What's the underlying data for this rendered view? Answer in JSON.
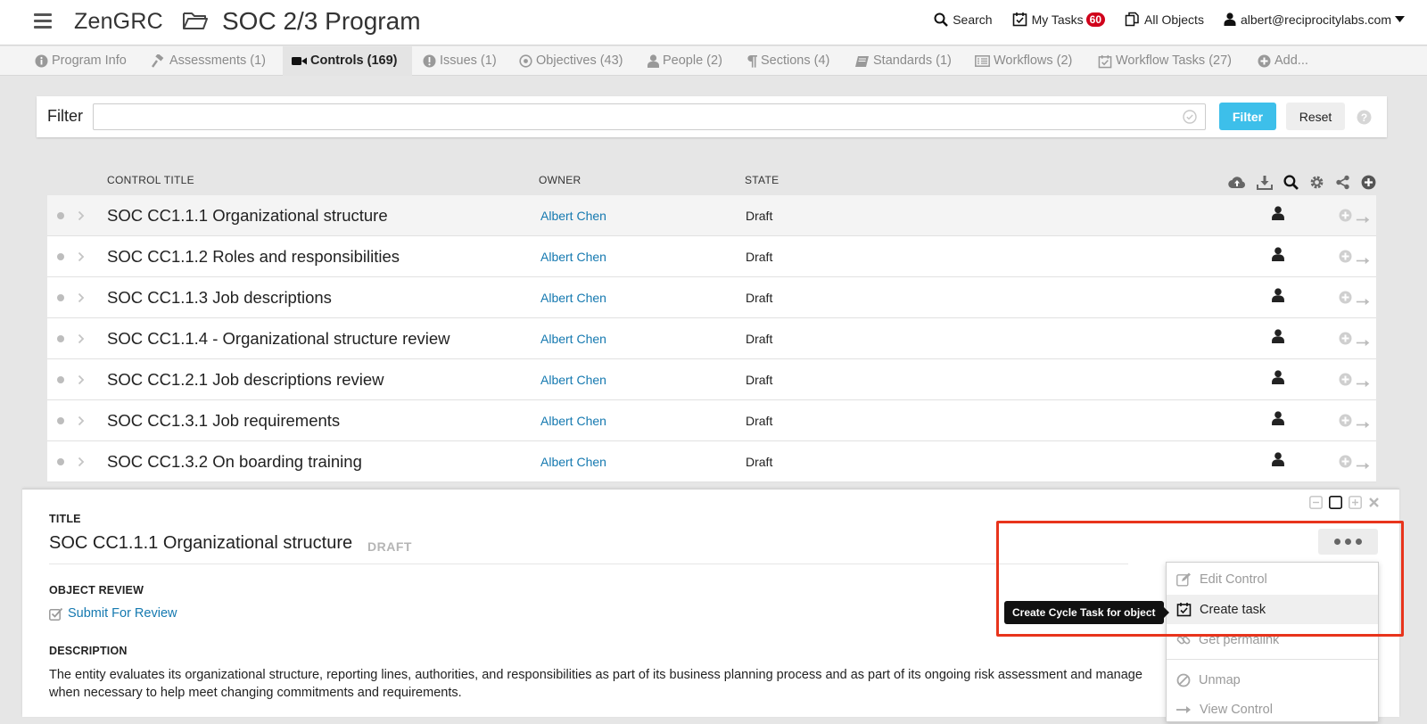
{
  "app": {
    "brand": "ZenGRC",
    "page_title": "SOC 2/3 Program"
  },
  "header": {
    "search_label": "Search",
    "my_tasks_label": "My Tasks",
    "my_tasks_count": "60",
    "all_objects_label": "All Objects",
    "user_email": "albert@reciprocitylabs.com"
  },
  "tabs": [
    {
      "label": "Program Info",
      "icon": "info-icon"
    },
    {
      "label": "Assessments (1)",
      "icon": "gavel-icon"
    },
    {
      "label": "Controls (169)",
      "icon": "video-camera-icon",
      "active": true
    },
    {
      "label": "Issues (1)",
      "icon": "exclamation-icon"
    },
    {
      "label": "Objectives (43)",
      "icon": "target-icon"
    },
    {
      "label": "People (2)",
      "icon": "person-icon"
    },
    {
      "label": "Sections (4)",
      "icon": "paragraph-icon"
    },
    {
      "label": "Standards (1)",
      "icon": "book-icon"
    },
    {
      "label": "Workflows (2)",
      "icon": "list-icon"
    },
    {
      "label": "Workflow Tasks (27)",
      "icon": "calendar-check-icon"
    },
    {
      "label": "Add...",
      "icon": "plus-circle-icon"
    }
  ],
  "filter": {
    "label": "Filter",
    "value": "",
    "filter_button": "Filter",
    "reset_button": "Reset"
  },
  "table": {
    "columns": {
      "title": "CONTROL TITLE",
      "owner": "OWNER",
      "state": "STATE"
    },
    "rows": [
      {
        "title": "SOC CC1.1.1 Organizational structure",
        "owner": "Albert Chen",
        "state": "Draft"
      },
      {
        "title": "SOC CC1.1.2 Roles and responsibilities",
        "owner": "Albert Chen",
        "state": "Draft"
      },
      {
        "title": "SOC CC1.1.3 Job descriptions",
        "owner": "Albert Chen",
        "state": "Draft"
      },
      {
        "title": "SOC CC1.1.4 - Organizational structure review",
        "owner": "Albert Chen",
        "state": "Draft"
      },
      {
        "title": "SOC CC1.2.1 Job descriptions review",
        "owner": "Albert Chen",
        "state": "Draft"
      },
      {
        "title": "SOC CC1.3.1 Job requirements",
        "owner": "Albert Chen",
        "state": "Draft"
      },
      {
        "title": "SOC CC1.3.2 On boarding training",
        "owner": "Albert Chen",
        "state": "Draft"
      }
    ]
  },
  "info_pane": {
    "title_label": "TITLE",
    "title": "SOC CC1.1.1 Organizational structure",
    "state": "DRAFT",
    "review_label": "OBJECT REVIEW",
    "review_link": "Submit For Review",
    "description_label": "DESCRIPTION",
    "description_line1": "The entity evaluates its organizational structure, reporting lines, authorities, and responsibilities as part of its business planning process and as part of its ongoing risk assessment and manage",
    "description_line2": "when necessary to help meet changing commitments and requirements."
  },
  "menu": {
    "items": [
      {
        "label": "Edit Control",
        "icon": "pencil-icon"
      },
      {
        "label": "Create task",
        "icon": "calendar-check-icon"
      },
      {
        "label": "Get permalink",
        "icon": "link-icon"
      },
      {
        "label": "Unmap",
        "icon": "ban-icon"
      },
      {
        "label": "View Control",
        "icon": "arrow-right-icon"
      }
    ],
    "tooltip": "Create Cycle Task for object"
  },
  "colors": {
    "accent": "#3dbfea",
    "link": "#1579b0",
    "badge": "#d0021b",
    "highlight": "#e8341c"
  }
}
